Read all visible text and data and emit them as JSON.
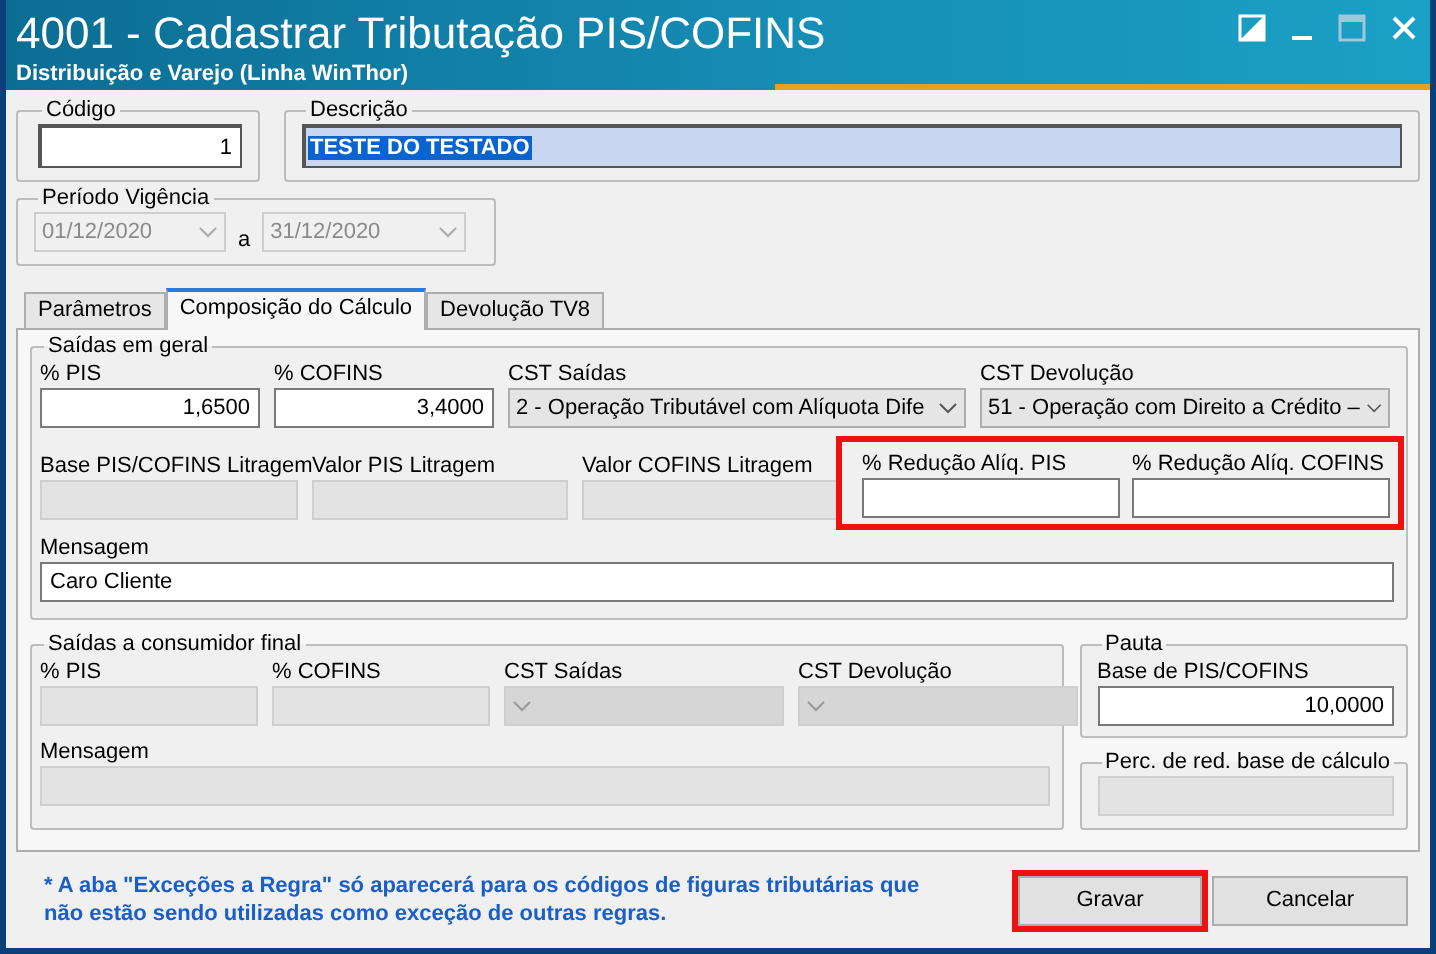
{
  "window": {
    "title": "4001 - Cadastrar Tributação PIS/COFINS",
    "subtitle": "Distribuição e Varejo (Linha WinThor)"
  },
  "codigo": {
    "label": "Código",
    "value": "1"
  },
  "descricao": {
    "label": "Descrição",
    "value": "TESTE DO TESTADO",
    "text_selected": true
  },
  "periodo": {
    "label": "Período Vigência",
    "separator": "a",
    "dates": [
      {
        "value": "01/12/2020",
        "disabled": true
      },
      {
        "value": "31/12/2020",
        "disabled": true
      }
    ]
  },
  "tabs": [
    {
      "label": "Parâmetros",
      "selected": false
    },
    {
      "label": "Composição do Cálculo",
      "selected": true
    },
    {
      "label": "Devolução TV8",
      "selected": false
    }
  ],
  "saidas_geral": {
    "title": "Saídas em geral",
    "row_1": [
      {
        "label": "% PIS",
        "kind": "input",
        "value": "1,6500",
        "disabled": false
      },
      {
        "label": "% COFINS",
        "kind": "input",
        "value": "3,4000",
        "disabled": false
      },
      {
        "label": "CST Saídas",
        "kind": "select",
        "value": "2 - Operação Tributável com Alíquota Dife",
        "disabled": false
      },
      {
        "label": "CST Devolução",
        "kind": "select",
        "value": "51 - Operação com Direito a Crédito –",
        "disabled": false
      }
    ],
    "row_2": [
      {
        "label": "Base PIS/COFINS Litragem",
        "kind": "input",
        "disabled": true
      },
      {
        "label": "Valor PIS Litragem",
        "kind": "input",
        "disabled": true
      },
      {
        "label": "Valor COFINS Litragem",
        "kind": "input",
        "disabled": true
      }
    ],
    "reducao": {
      "highlighted": true,
      "fields": [
        {
          "label": "% Redução Alíq. PIS",
          "kind": "input",
          "disabled": false
        },
        {
          "label": "% Redução Alíq. COFINS",
          "kind": "input",
          "disabled": false
        }
      ]
    },
    "mensagem": {
      "label": "Mensagem",
      "value": "Caro Cliente",
      "disabled": false
    }
  },
  "consumidor_final": {
    "title": "Saídas a consumidor final",
    "row_1": [
      {
        "label": "% PIS",
        "kind": "input",
        "disabled": true
      },
      {
        "label": "% COFINS",
        "kind": "input",
        "disabled": true
      },
      {
        "label": "CST Saídas",
        "kind": "select",
        "disabled": true
      },
      {
        "label": "CST Devolução",
        "kind": "select",
        "disabled": true
      }
    ],
    "mensagem": {
      "label": "Mensagem",
      "disabled": true
    }
  },
  "pauta": {
    "title": "Pauta",
    "label": "Base de PIS/COFINS",
    "value": "10,0000"
  },
  "perc_red": {
    "title": "Perc. de red. base de cálculo",
    "disabled": true
  },
  "footer": {
    "note": "* A aba \"Exceções a Regra\" só aparecerá para os códigos de figuras tributárias que não estão sendo utilizadas como exceção de outras regras.",
    "buttons": [
      {
        "label": "Gravar",
        "highlighted": true
      },
      {
        "label": "Cancelar",
        "highlighted": false
      }
    ]
  }
}
